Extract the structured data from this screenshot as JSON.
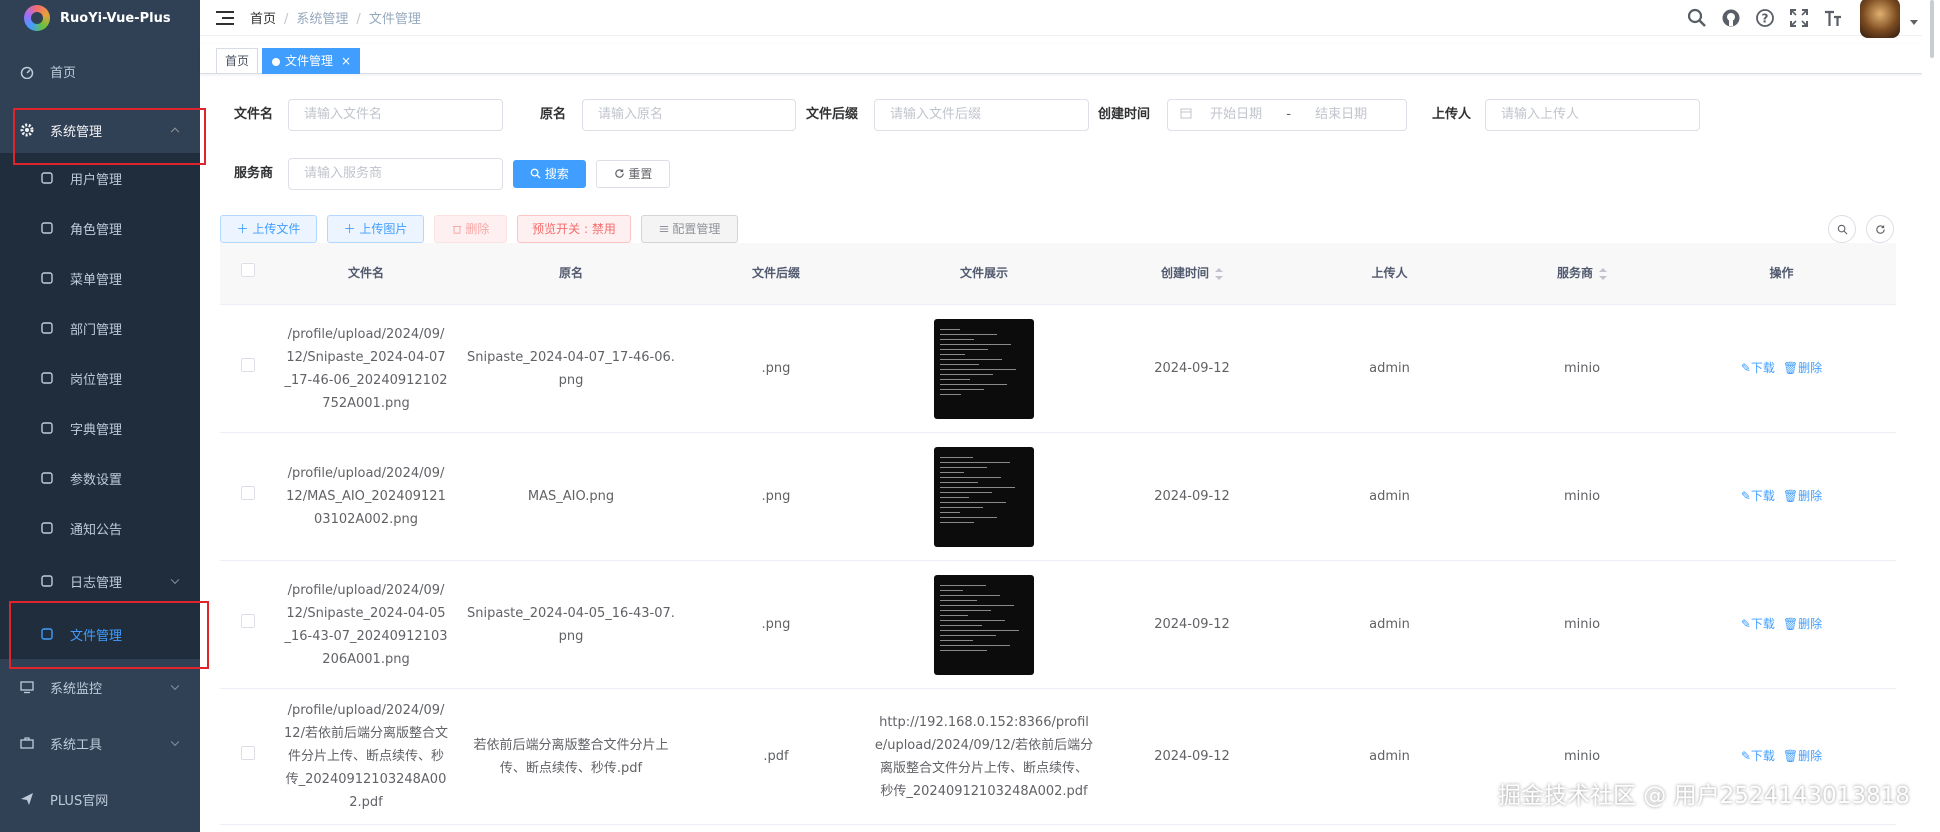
{
  "app": {
    "title": "RuoYi-Vue-Plus"
  },
  "sidebar": {
    "home": "首页",
    "system": {
      "label": "系统管理",
      "items": [
        "用户管理",
        "角色管理",
        "菜单管理",
        "部门管理",
        "岗位管理",
        "字典管理",
        "参数设置",
        "通知公告",
        "日志管理",
        "文件管理"
      ]
    },
    "monitor": "系统监控",
    "tools": "系统工具",
    "plus": "PLUS官网"
  },
  "header": {
    "breadcrumb": [
      "首页",
      "系统管理",
      "文件管理"
    ]
  },
  "tags": {
    "home": "首页",
    "current": "文件管理"
  },
  "filters": {
    "file_name": {
      "label": "文件名",
      "placeholder": "请输入文件名"
    },
    "original": {
      "label": "原名",
      "placeholder": "请输入原名"
    },
    "suffix": {
      "label": "文件后缀",
      "placeholder": "请输入文件后缀"
    },
    "created": {
      "label": "创建时间",
      "start": "开始日期",
      "sep": "-",
      "end": "结束日期"
    },
    "uploader": {
      "label": "上传人",
      "placeholder": "请输入上传人"
    },
    "service": {
      "label": "服务商",
      "placeholder": "请输入服务商"
    },
    "search_btn": "搜索",
    "reset_btn": "重置"
  },
  "toolbar": {
    "upload_file": "上传文件",
    "upload_image": "上传图片",
    "delete": "删除",
    "preview": "预览开关 : 禁用",
    "config": "配置管理"
  },
  "table": {
    "headers": [
      "文件名",
      "原名",
      "文件后缀",
      "文件展示",
      "创建时间",
      "上传人",
      "服务商",
      "操作"
    ],
    "actions": {
      "download": "下载",
      "delete": "删除"
    },
    "rows": [
      {
        "file": "/profile/upload/2024/09/12/Snipaste_2024-04-07_17-46-06_20240912102752A001.png",
        "orig": "Snipaste_2024-04-07_17-46-06.png",
        "suffix": ".png",
        "preview": "",
        "created": "2024-09-12",
        "uploader": "admin",
        "service": "minio"
      },
      {
        "file": "/profile/upload/2024/09/12/MAS_AIO_20240912103102A002.png",
        "orig": "MAS_AIO.png",
        "suffix": ".png",
        "preview": "",
        "created": "2024-09-12",
        "uploader": "admin",
        "service": "minio"
      },
      {
        "file": "/profile/upload/2024/09/12/Snipaste_2024-04-05_16-43-07_20240912103206A001.png",
        "orig": "Snipaste_2024-04-05_16-43-07.png",
        "suffix": ".png",
        "preview": "",
        "created": "2024-09-12",
        "uploader": "admin",
        "service": "minio"
      },
      {
        "file": "/profile/upload/2024/09/12/若依前后端分离版整合文件分片上传、断点续传、秒传_20240912103248A002.pdf",
        "orig": "若依前后端分离版整合文件分片上传、断点续传、秒传.pdf",
        "suffix": ".pdf",
        "preview": "http://192.168.0.152:8366/profile/upload/2024/09/12/若依前后端分离版整合文件分片上传、断点续传、秒传_20240912103248A002.pdf",
        "created": "2024-09-12",
        "uploader": "admin",
        "service": "minio"
      }
    ]
  },
  "watermark": "掘金技术社区 @ 用户2524143013818"
}
